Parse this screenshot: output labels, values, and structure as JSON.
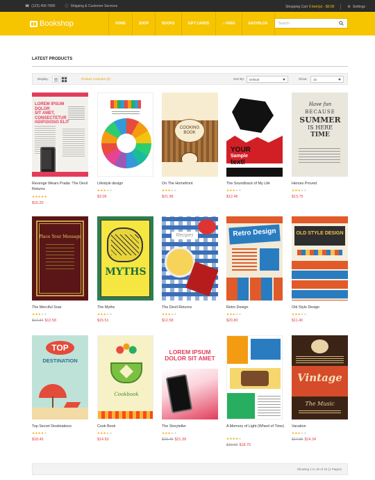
{
  "topbar": {
    "phone": "(123) 456-7890",
    "shipping": "Shipping & Customer Services",
    "cart_label": "Shopping Cart",
    "cart_count": "0 item(s) - $0.00",
    "settings": "Settings"
  },
  "header": {
    "logo": "Bookshop",
    "nav": [
      "HOME",
      "SHOP",
      "BOOKS",
      "GIFT CARDS",
      "FREE",
      "EASYBLOG"
    ],
    "search_placeholder": "Search",
    "brand_color": "#f7c400"
  },
  "section": {
    "title": "LATEST PRODUCTS"
  },
  "toolbar": {
    "display_label": "Display:",
    "compare": "Product Compare (0)",
    "sort_label": "Sort By:",
    "sort_value": "Default",
    "show_label": "Show:",
    "show_value": "15"
  },
  "products": [
    {
      "name": "Revenge Wears Prada: The Devil Returns",
      "rating": 5,
      "price": "$16.20",
      "old_price": ""
    },
    {
      "name": "Lifestyle design",
      "rating": 3,
      "price": "$3.06",
      "old_price": ""
    },
    {
      "name": "On The Homefront",
      "rating": 3,
      "price": "$21.98",
      "old_price": ""
    },
    {
      "name": "The Soundtrack of My Life",
      "rating": 3,
      "price": "$12.46",
      "old_price": ""
    },
    {
      "name": "Heroes Proved",
      "rating": 3,
      "price": "$13.75",
      "old_price": ""
    },
    {
      "name": "The Merciful Soar",
      "rating": 3,
      "price": "$12.58",
      "old_price": "$14.34"
    },
    {
      "name": "The Myths",
      "rating": 3,
      "price": "$15.51",
      "old_price": ""
    },
    {
      "name": "The Devil Returns",
      "rating": 3,
      "price": "$12.58",
      "old_price": ""
    },
    {
      "name": "Retro Design",
      "rating": 3,
      "price": "$20.80",
      "old_price": ""
    },
    {
      "name": "Old Style Design",
      "rating": 3,
      "price": "$11.40",
      "old_price": ""
    },
    {
      "name": "Top Secret Destinations",
      "rating": 3,
      "price": "$18.45",
      "old_price": ""
    },
    {
      "name": "Cook Book",
      "rating": 3,
      "price": "$14.93",
      "old_price": ""
    },
    {
      "name": "The Storyteller",
      "rating": 3,
      "price": "$21.39",
      "old_price": "$23.45"
    },
    {
      "name": "A Memory of Light (Wheel of Time)",
      "rating": 3,
      "price": "$18.70",
      "old_price": "$19.60"
    },
    {
      "name": "Vacation",
      "rating": 3,
      "price": "$14.34",
      "old_price": "$17.86"
    }
  ],
  "covers": {
    "c1": {
      "line1": "LOREM IPSUM DOLOR",
      "line2": "SIT AMET, CONSECTETUR",
      "line3": "ADIPISCING ELIT"
    },
    "c3": {
      "line1": "COOKING",
      "line2": "BOOK"
    },
    "c4": {
      "line1": "YOUR",
      "line2": "Sample",
      "line3": "text!"
    },
    "c5": {
      "line1": "Have fun",
      "line2": "BECAUSE",
      "line3": "SUMMER",
      "line4": "IS HERE",
      "line5": "TIME"
    },
    "c6": {
      "line1": "Place Your Message"
    },
    "c7": {
      "line1": "MYTHS"
    },
    "c8": {
      "line1": "Recipes"
    },
    "c9": {
      "line1": "Retro Design"
    },
    "c10": {
      "line1": "OLD STYLE DESIGN"
    },
    "c11": {
      "line1": "TOP",
      "line2": "DESTINATION"
    },
    "c12": {
      "line1": "Cookbook"
    },
    "c13": {
      "line1": "LOREM IPSUM",
      "line2": "DOLOR SIT AMET"
    },
    "c15": {
      "line1": "Vintage",
      "line2": "The Music"
    }
  },
  "pager": {
    "info": "Showing 1 to 15 of 15 (1 Pages)"
  }
}
